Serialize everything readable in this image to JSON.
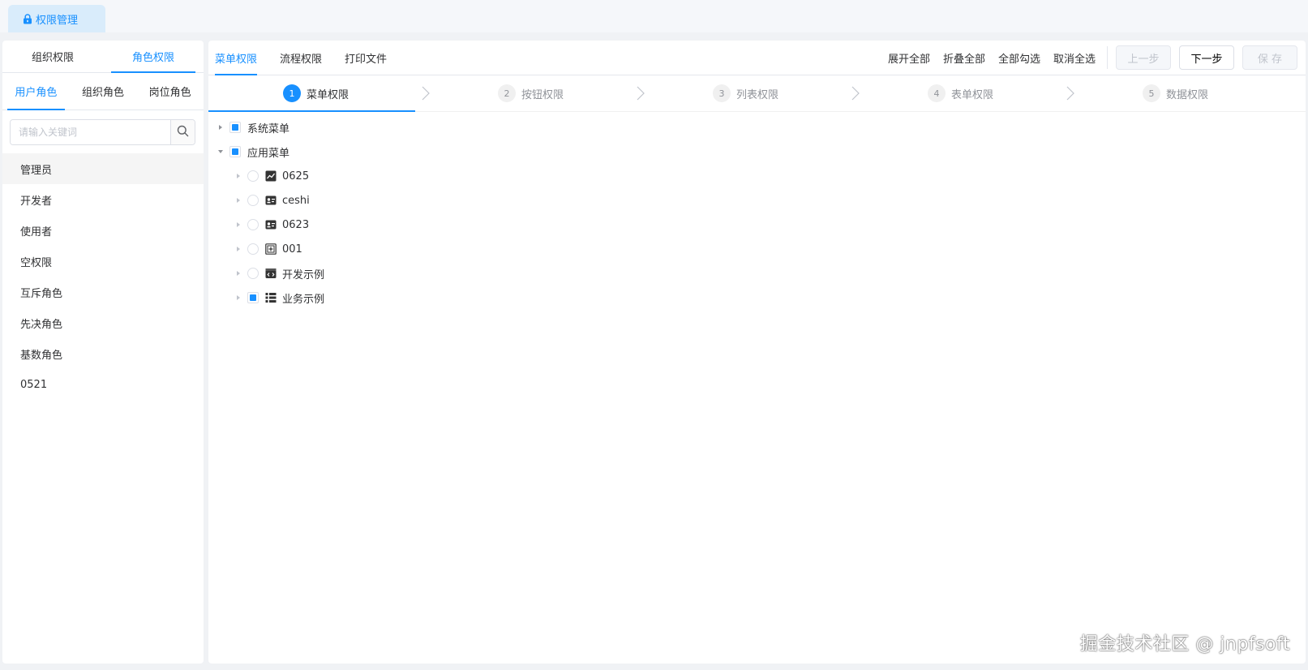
{
  "page_tab": {
    "label": "权限管理",
    "icon": "lock-icon"
  },
  "left": {
    "tabs": [
      "组织权限",
      "角色权限"
    ],
    "active_tab": 1,
    "subtabs": [
      "用户角色",
      "组织角色",
      "岗位角色"
    ],
    "active_subtab": 0,
    "search": {
      "placeholder": "请输入关键词",
      "value": ""
    },
    "roles": [
      "管理员",
      "开发者",
      "使用者",
      "空权限",
      "互斥角色",
      "先决角色",
      "基数角色",
      "0521"
    ],
    "selected_role": 0
  },
  "main": {
    "tabs": [
      "菜单权限",
      "流程权限",
      "打印文件"
    ],
    "active_tab": 0,
    "toolbar": {
      "expand_all": "展开全部",
      "collapse_all": "折叠全部",
      "check_all": "全部勾选",
      "uncheck_all": "取消全选",
      "prev": "上一步",
      "next": "下一步",
      "save": "保 存"
    },
    "steps": [
      {
        "num": "1",
        "label": "菜单权限"
      },
      {
        "num": "2",
        "label": "按钮权限"
      },
      {
        "num": "3",
        "label": "列表权限"
      },
      {
        "num": "4",
        "label": "表单权限"
      },
      {
        "num": "5",
        "label": "数据权限"
      }
    ],
    "active_step": 0,
    "tree": [
      {
        "label": "系统菜单",
        "level": 0,
        "expanded": false,
        "check": "indeterminate"
      },
      {
        "label": "应用菜单",
        "level": 0,
        "expanded": true,
        "check": "indeterminate"
      },
      {
        "label": "0625",
        "level": 1,
        "expanded": false,
        "check": "none",
        "icon": "line-chart-icon"
      },
      {
        "label": "ceshi",
        "level": 1,
        "expanded": false,
        "check": "none",
        "icon": "id-card-icon"
      },
      {
        "label": "0623",
        "level": 1,
        "expanded": false,
        "check": "none",
        "icon": "id-card-icon"
      },
      {
        "label": "001",
        "level": 1,
        "expanded": false,
        "check": "none",
        "icon": "plus-square-icon"
      },
      {
        "label": "开发示例",
        "level": 1,
        "expanded": false,
        "check": "none",
        "icon": "code-window-icon"
      },
      {
        "label": "业务示例",
        "level": 1,
        "expanded": false,
        "check": "indeterminate",
        "icon": "list-icon"
      }
    ]
  },
  "watermark": "掘金技术社区 @ jnpfsoft",
  "colors": {
    "accent": "#1890ff",
    "page_bg": "#f0f2f5"
  }
}
